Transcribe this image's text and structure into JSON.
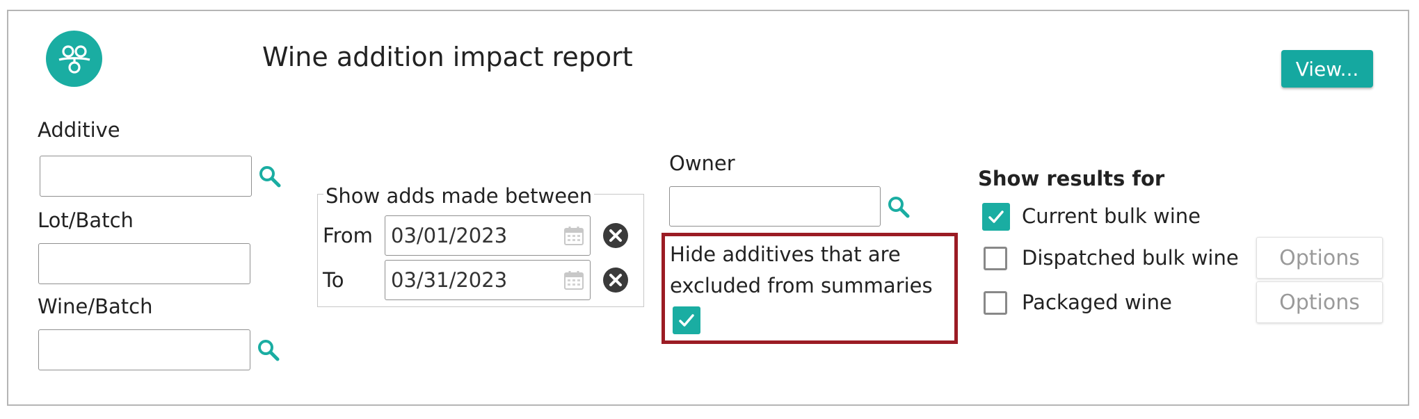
{
  "header": {
    "title": "Wine addition impact report",
    "view_button": "View..."
  },
  "filters": {
    "additive": {
      "label": "Additive",
      "value": ""
    },
    "lot_batch": {
      "label": "Lot/Batch",
      "value": ""
    },
    "wine_batch": {
      "label": "Wine/Batch",
      "value": ""
    },
    "owner": {
      "label": "Owner",
      "value": ""
    }
  },
  "date_range": {
    "legend": "Show adds made between",
    "from_label": "From",
    "from_value": "03/01/2023",
    "to_label": "To",
    "to_value": "03/31/2023"
  },
  "hide_additives": {
    "label_line1": "Hide additives that are",
    "label_line2": "excluded from summaries",
    "checked": true
  },
  "show_results": {
    "title": "Show results for",
    "items": [
      {
        "label": "Current bulk wine",
        "checked": true
      },
      {
        "label": "Dispatched bulk wine",
        "checked": false,
        "options_label": "Options"
      },
      {
        "label": "Packaged wine",
        "checked": false,
        "options_label": "Options"
      }
    ]
  },
  "colors": {
    "accent": "#1aada2",
    "highlight_border": "#9b1c24"
  }
}
